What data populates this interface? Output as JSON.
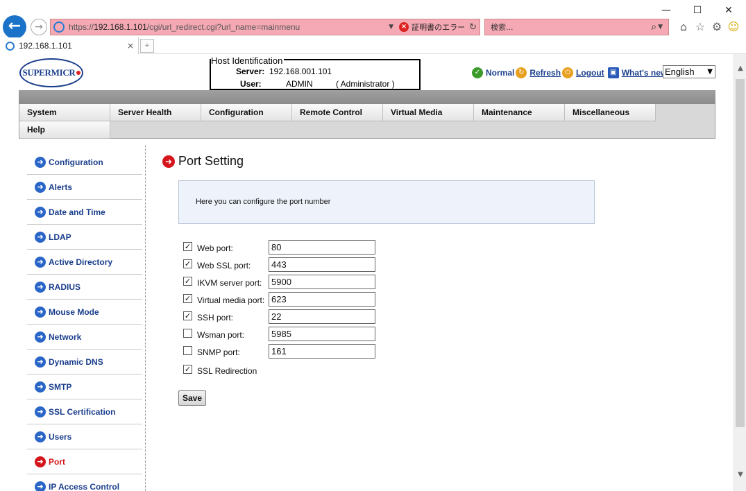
{
  "browser": {
    "url_prefix": "https://",
    "url_host": "192.168.1.101",
    "url_path": "/cgi/url_redirect.cgi?url_name=mainmenu",
    "cert_error": "証明書のエラー",
    "search_placeholder": "検索...",
    "tab_title": "192.168.1.101",
    "window_controls": {
      "minimize": "—",
      "maximize": "☐",
      "close": "✕"
    }
  },
  "header": {
    "logo_text": "SUPERMICR",
    "host_legend": "Host Identification",
    "server_label": "Server:",
    "server_value": "192.168.001.101",
    "user_label": "User:",
    "user_value": "ADMIN",
    "user_role": "( Administrator )",
    "links": {
      "normal": "Normal",
      "refresh": "Refresh",
      "logout": "Logout",
      "whats_new": "What's  new"
    },
    "language": "English"
  },
  "menu": {
    "items": [
      "System",
      "Server Health",
      "Configuration",
      "Remote Control",
      "Virtual Media",
      "Maintenance",
      "Miscellaneous",
      "Help"
    ]
  },
  "sidebar": {
    "items": [
      {
        "label": "Configuration",
        "active": false
      },
      {
        "label": "Alerts",
        "active": false
      },
      {
        "label": "Date and Time",
        "active": false
      },
      {
        "label": "LDAP",
        "active": false
      },
      {
        "label": "Active Directory",
        "active": false
      },
      {
        "label": "RADIUS",
        "active": false
      },
      {
        "label": "Mouse Mode",
        "active": false
      },
      {
        "label": "Network",
        "active": false
      },
      {
        "label": "Dynamic DNS",
        "active": false
      },
      {
        "label": "SMTP",
        "active": false
      },
      {
        "label": "SSL Certification",
        "active": false
      },
      {
        "label": "Users",
        "active": false
      },
      {
        "label": "Port",
        "active": true
      },
      {
        "label": "IP Access Control",
        "active": false
      }
    ]
  },
  "main": {
    "title": "Port Setting",
    "info": "Here you can configure the port number",
    "ports": [
      {
        "label": "Web port:",
        "checked": true,
        "value": "80"
      },
      {
        "label": "Web SSL port:",
        "checked": true,
        "value": "443"
      },
      {
        "label": "IKVM server port:",
        "checked": true,
        "value": "5900"
      },
      {
        "label": "Virtual media port:",
        "checked": true,
        "value": "623"
      },
      {
        "label": "SSH port:",
        "checked": true,
        "value": "22"
      },
      {
        "label": "Wsman port:",
        "checked": false,
        "value": "5985"
      },
      {
        "label": "SNMP port:",
        "checked": false,
        "value": "161"
      }
    ],
    "ssl_redirection": {
      "label": "SSL Redirection",
      "checked": true
    },
    "save_label": "Save"
  },
  "colors": {
    "accent_red": "#d4161c",
    "link_blue": "#1a3e8c",
    "addr_error_bg": "#f4a9b4"
  }
}
